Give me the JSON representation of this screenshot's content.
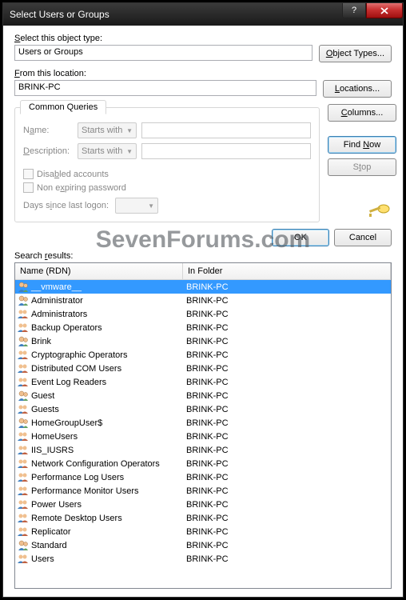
{
  "title": "Select Users or Groups",
  "object_type_label": "Select this object type:",
  "object_type_value": "Users or Groups",
  "object_types_btn": "Object Types...",
  "location_label": "From this location:",
  "location_value": "BRINK-PC",
  "locations_btn": "Locations...",
  "tab_label": "Common Queries",
  "name_label": "Name:",
  "starts_with": "Starts with",
  "desc_label": "Description:",
  "disabled_label": "Disabled accounts",
  "nonexp_label": "Non expiring password",
  "days_label": "Days since last logon:",
  "columns_btn": "Columns...",
  "find_now_btn": "Find Now",
  "stop_btn": "Stop",
  "ok_btn": "OK",
  "cancel_btn": "Cancel",
  "results_label": "Search results:",
  "hdr_name": "Name (RDN)",
  "hdr_folder": "In Folder",
  "watermark": "SevenForums.com",
  "rows": [
    {
      "name": "__vmware__",
      "folder": "BRINK-PC",
      "type": "user",
      "selected": true
    },
    {
      "name": "Administrator",
      "folder": "BRINK-PC",
      "type": "user"
    },
    {
      "name": "Administrators",
      "folder": "BRINK-PC",
      "type": "group"
    },
    {
      "name": "Backup Operators",
      "folder": "BRINK-PC",
      "type": "group"
    },
    {
      "name": "Brink",
      "folder": "BRINK-PC",
      "type": "user"
    },
    {
      "name": "Cryptographic Operators",
      "folder": "BRINK-PC",
      "type": "group"
    },
    {
      "name": "Distributed COM Users",
      "folder": "BRINK-PC",
      "type": "group"
    },
    {
      "name": "Event Log Readers",
      "folder": "BRINK-PC",
      "type": "group"
    },
    {
      "name": "Guest",
      "folder": "BRINK-PC",
      "type": "user"
    },
    {
      "name": "Guests",
      "folder": "BRINK-PC",
      "type": "group"
    },
    {
      "name": "HomeGroupUser$",
      "folder": "BRINK-PC",
      "type": "user"
    },
    {
      "name": "HomeUsers",
      "folder": "BRINK-PC",
      "type": "group"
    },
    {
      "name": "IIS_IUSRS",
      "folder": "BRINK-PC",
      "type": "group"
    },
    {
      "name": "Network Configuration Operators",
      "folder": "BRINK-PC",
      "type": "group"
    },
    {
      "name": "Performance Log Users",
      "folder": "BRINK-PC",
      "type": "group"
    },
    {
      "name": "Performance Monitor Users",
      "folder": "BRINK-PC",
      "type": "group"
    },
    {
      "name": "Power Users",
      "folder": "BRINK-PC",
      "type": "group"
    },
    {
      "name": "Remote Desktop Users",
      "folder": "BRINK-PC",
      "type": "group"
    },
    {
      "name": "Replicator",
      "folder": "BRINK-PC",
      "type": "group"
    },
    {
      "name": "Standard",
      "folder": "BRINK-PC",
      "type": "user"
    },
    {
      "name": "Users",
      "folder": "BRINK-PC",
      "type": "group"
    }
  ]
}
